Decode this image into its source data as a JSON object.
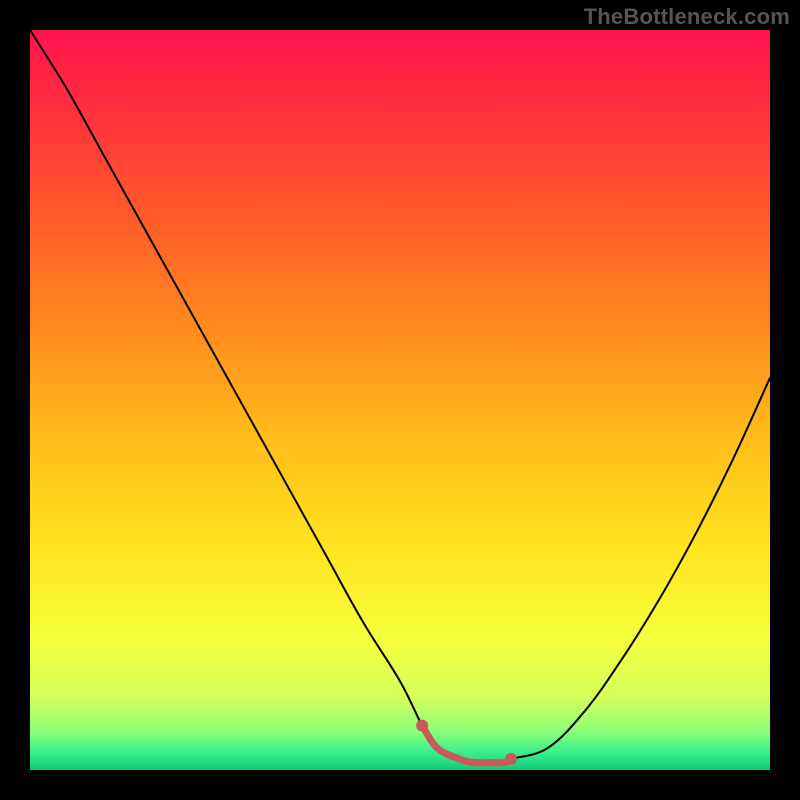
{
  "watermark": "TheBottleneck.com",
  "chart_data": {
    "type": "line",
    "title": "",
    "xlabel": "",
    "ylabel": "",
    "xlim": [
      0,
      100
    ],
    "ylim": [
      0,
      100
    ],
    "grid": false,
    "legend": false,
    "annotations": [],
    "background_gradient": {
      "stops": [
        {
          "offset": 0.0,
          "color": "#ff1450"
        },
        {
          "offset": 0.1,
          "color": "#ff2d3d"
        },
        {
          "offset": 0.25,
          "color": "#ff5a2a"
        },
        {
          "offset": 0.4,
          "color": "#ff8a1f"
        },
        {
          "offset": 0.55,
          "color": "#ffbc1a"
        },
        {
          "offset": 0.7,
          "color": "#ffe41e"
        },
        {
          "offset": 0.82,
          "color": "#f6ff3c"
        },
        {
          "offset": 0.9,
          "color": "#d6ff5a"
        },
        {
          "offset": 0.95,
          "color": "#86ff78"
        },
        {
          "offset": 0.975,
          "color": "#3df08d"
        },
        {
          "offset": 1.0,
          "color": "#14c87a"
        }
      ]
    },
    "series": [
      {
        "name": "bottleneck-curve",
        "color": "#000000",
        "stroke_width": 2,
        "x": [
          0,
          5,
          10,
          15,
          20,
          25,
          30,
          35,
          40,
          45,
          50,
          53,
          55,
          58,
          60,
          63,
          65,
          70,
          75,
          80,
          85,
          90,
          95,
          100
        ],
        "values": [
          100,
          92,
          83,
          74,
          65,
          56,
          47,
          38,
          29,
          20,
          12,
          6,
          3,
          1.5,
          1,
          1,
          1.5,
          3,
          8,
          15,
          23,
          32,
          42,
          53
        ]
      }
    ],
    "highlight": {
      "name": "flat-valley",
      "color": "#c85a5a",
      "stroke_width": 7,
      "dots": true,
      "x": [
        53,
        55,
        58,
        60,
        62,
        64,
        65
      ],
      "values": [
        6,
        3,
        1.5,
        1,
        1,
        1,
        1.5
      ]
    }
  }
}
